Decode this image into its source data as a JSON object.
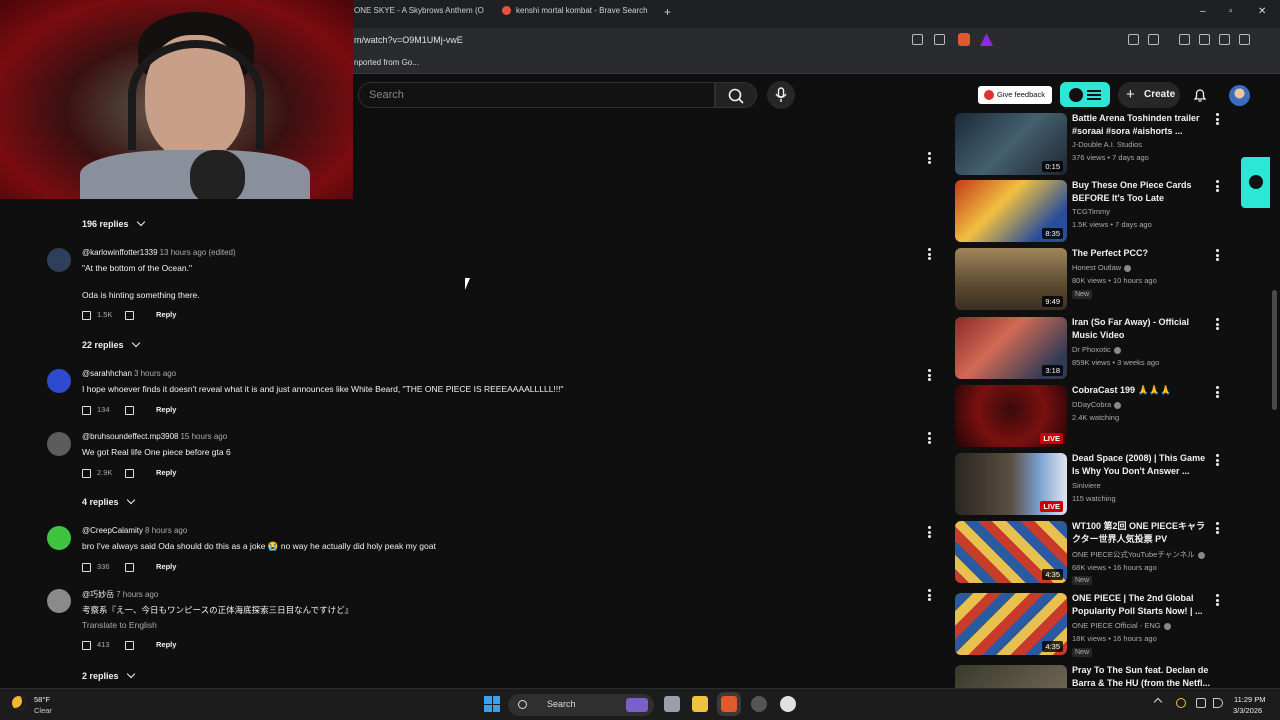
{
  "browser": {
    "tabs": [
      {
        "label": "ONE SKYE - A Skybrows Anthem (O"
      },
      {
        "label": "kenshi mortal kombat - Brave Search"
      }
    ],
    "url": "m/watch?v=O9M1UMj-vwE",
    "bookmark": "nported from Go..."
  },
  "header": {
    "search_placeholder": "Search",
    "feedback_label": "Give feedback",
    "create_label": "Create"
  },
  "comments": [
    {
      "replies_label": "196 replies"
    },
    {
      "author": "@karlowinffotter1339",
      "time": "13 hours ago (edited)",
      "lines": [
        "\"At the bottom of the Ocean.\"",
        "Oda is hinting something there."
      ],
      "likes": "1.5K",
      "reply": "Reply",
      "replies_label": "22 replies"
    },
    {
      "author": "@sarahhchan",
      "time": "3 hours ago",
      "lines": [
        "I hope whoever finds it doesn't reveal what it is and just announces like White Beard, \"THE ONE PIECE IS REEEAAAALLLLL!!!\""
      ],
      "likes": "134",
      "reply": "Reply"
    },
    {
      "author": "@bruhsoundeffect.mp3908",
      "time": "15 hours ago",
      "lines": [
        "We got Real life One piece before gta 6"
      ],
      "likes": "2.9K",
      "reply": "Reply",
      "replies_label": "4 replies"
    },
    {
      "author": "@CreepCalamity",
      "time": "8 hours ago",
      "lines": [
        "bro I've always said Oda should do this as a joke 😭 no way he actually did holy peak my goat"
      ],
      "likes": "336",
      "reply": "Reply"
    },
    {
      "author": "@巧妙岳",
      "time": "7 hours ago",
      "lines": [
        "考察系『え一、今日もワンピースの正体海底探索三日目なんですけど』"
      ],
      "translate": "Translate to English",
      "likes": "413",
      "reply": "Reply",
      "replies_label": "2 replies"
    }
  ],
  "related": [
    {
      "title": "Battle Arena Toshinden trailer #soraai #sora #aishorts ...",
      "channel": "J-Double A.I. Studios",
      "meta": "376 views • 7 days ago",
      "duration": "0:15"
    },
    {
      "title": "Buy These One Piece Cards BEFORE It's Too Late",
      "channel": "TCGTimmy",
      "meta": "1.5K views • 7 days ago",
      "duration": "8:35"
    },
    {
      "title": "The Perfect PCC?",
      "channel": "Honest Outlaw",
      "meta": "80K views • 10 hours ago",
      "badge": "New",
      "duration": "9:49"
    },
    {
      "title": "Iran (So Far Away) - Official Music Video",
      "channel": "Dr Phoxotic",
      "meta": "859K views • 3 weeks ago",
      "duration": "3:18"
    },
    {
      "title": "CobraCast 199 🙏🙏🙏",
      "channel": "DDayCobra",
      "meta": "2.4K watching",
      "live": "LIVE"
    },
    {
      "title": "Dead Space (2008) | This Game Is Why You Don't Answer ...",
      "channel": "Siniviere",
      "meta": "115 watching",
      "live": "LIVE"
    },
    {
      "title": "WT100 第2回 ONE PIECEキャラクター世界人気投票 PV",
      "channel": "ONE PIECE公式YouTubeチャンネル",
      "meta": "68K views • 16 hours ago",
      "badge": "New",
      "duration": "4:35"
    },
    {
      "title": "ONE PIECE | The 2nd Global Popularity Poll Starts Now! | ...",
      "channel": "ONE PIECE Official - ENG",
      "meta": "18K views • 16 hours ago",
      "badge": "New",
      "duration": "4:35"
    },
    {
      "title": "Pray To The Sun feat. Declan de Barra & The HU (from the Netfl..."
    }
  ],
  "taskbar": {
    "weather_temp": "58°F",
    "weather_desc": "Clear",
    "search_label": "Search",
    "time": "11:29 PM",
    "date": "3/3/2026"
  },
  "colors": {
    "accent": "#2ee6d6",
    "live": "#cc0000",
    "background": "#0f0f0f"
  }
}
